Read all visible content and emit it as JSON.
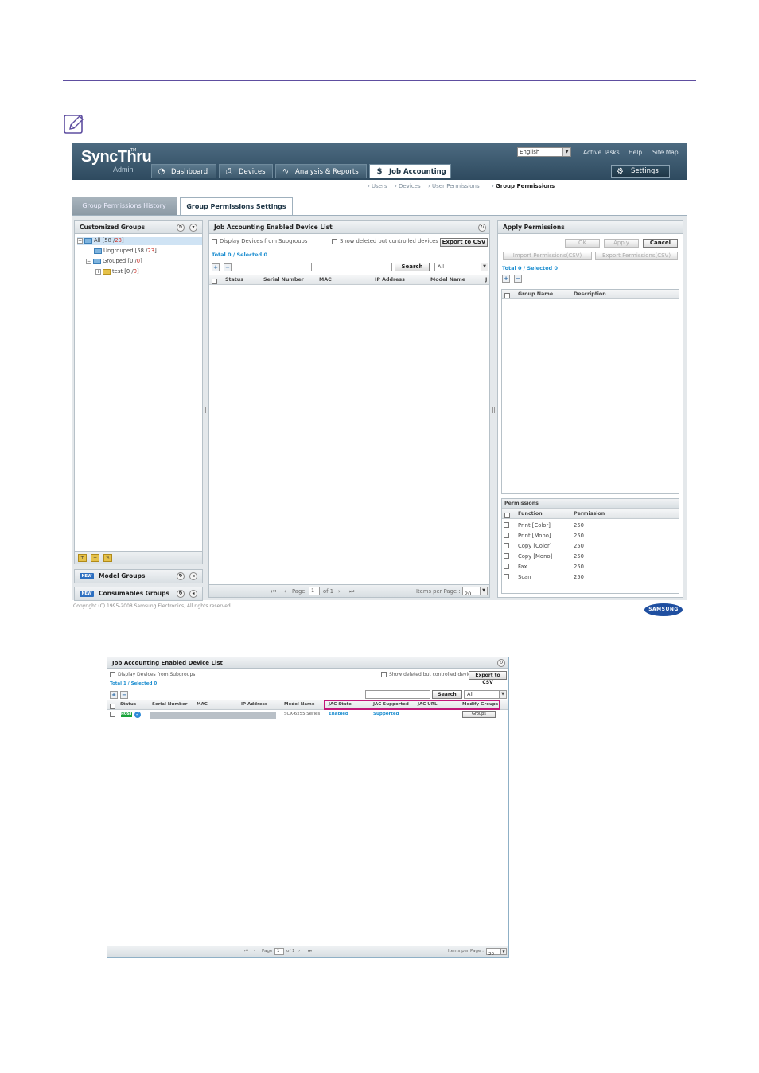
{
  "colors": {
    "accent_rule": "#5e4ea0",
    "header_bg": "#3a576b",
    "link_blue": "#1d8ed0",
    "highlight": "#c2187a",
    "status_ok": "#19a33a"
  },
  "note_icon": "pencil-note-icon",
  "app": {
    "logo": "SyncThru",
    "logo_sub": "Admin",
    "logo_tm": "TM",
    "language": "English",
    "top_links": [
      "Active Tasks",
      "Help",
      "Site Map"
    ],
    "tabs": [
      {
        "label": "Dashboard",
        "icon": "dashboard-icon"
      },
      {
        "label": "Devices",
        "icon": "printer-icon"
      },
      {
        "label": "Analysis & Reports",
        "icon": "chart-icon"
      },
      {
        "label": "Job Accounting",
        "icon": "dollar-icon"
      }
    ],
    "settings_label": "Settings",
    "breadcrumb": [
      "Users",
      "Devices",
      "User Permissions",
      "Group Permissions"
    ],
    "page_tabs": [
      "Group Permissions History",
      "Group Permissions Settings"
    ]
  },
  "left_panel": {
    "title": "Customized Groups",
    "tree": [
      {
        "label": "All",
        "count_a": "58",
        "count_b": "23"
      },
      {
        "label": "Ungrouped",
        "count_a": "58",
        "count_b": "23"
      },
      {
        "label": "Grouped",
        "count_a": "0",
        "count_b": "0"
      },
      {
        "label": "test",
        "count_a": "0",
        "count_b": "0"
      }
    ],
    "accordions": [
      {
        "badge": "NEW",
        "label": "Model Groups"
      },
      {
        "badge": "NEW",
        "label": "Consumables Groups"
      }
    ]
  },
  "device_list": {
    "title": "Job Accounting Enabled Device List",
    "display_subgroups": "Display Devices from Subgroups",
    "show_deleted": "Show deleted but controlled devices",
    "export_csv": "Export to CSV",
    "total": "Total 0 / Selected 0",
    "search_label": "Search",
    "filter_value": "All",
    "columns": [
      "Status",
      "Serial Number",
      "MAC",
      "IP Address",
      "Model Name",
      "J"
    ],
    "pager": {
      "page_label": "Page",
      "page_value": "1",
      "of_label": "of 1",
      "items_label": "Items per Page :",
      "items_value": "20"
    }
  },
  "apply_panel": {
    "title": "Apply Permissions",
    "ok": "OK",
    "apply": "Apply",
    "cancel": "Cancel",
    "import_csv": "Import Permissions(CSV)",
    "export_csv": "Export Permissions(CSV)",
    "total": "Total 0 / Selected 0",
    "columns": [
      "Group Name",
      "Description"
    ],
    "permissions_title": "Permissions",
    "perm_columns": [
      "Function",
      "Permission"
    ],
    "permissions": [
      {
        "function": "Print [Color]",
        "value": "250"
      },
      {
        "function": "Print [Mono]",
        "value": "250"
      },
      {
        "function": "Copy [Color]",
        "value": "250"
      },
      {
        "function": "Copy [Mono]",
        "value": "250"
      },
      {
        "function": "Fax",
        "value": "250"
      },
      {
        "function": "Scan",
        "value": "250"
      }
    ]
  },
  "footer": {
    "copyright": "Copyright (C) 1995-2008 Samsung Electronics, All rights reserved.",
    "brand": "SAMSUNG"
  },
  "second_list": {
    "title": "Job Accounting Enabled Device List",
    "display_subgroups": "Display Devices from Subgroups",
    "show_deleted": "Show deleted but controlled devices",
    "export_csv": "Export to CSV",
    "total": "Total 1 / Selected 0",
    "search_label": "Search",
    "filter_value": "All",
    "columns": [
      "Status",
      "Serial Number",
      "MAC",
      "IP Address",
      "Model Name",
      "JAC State",
      "JAC Supported",
      "JAC URL",
      "Modify Groups"
    ],
    "row": {
      "status_badge": "HOST",
      "model": "SCX-6x55 Series",
      "jac_state": "Enabled",
      "jac_supported": "Supported",
      "modify_button": "Groups"
    },
    "pager": {
      "page_label": "Page",
      "page_value": "1",
      "of_label": "of 1",
      "items_label": "Items per Page :",
      "items_value": "20"
    }
  }
}
